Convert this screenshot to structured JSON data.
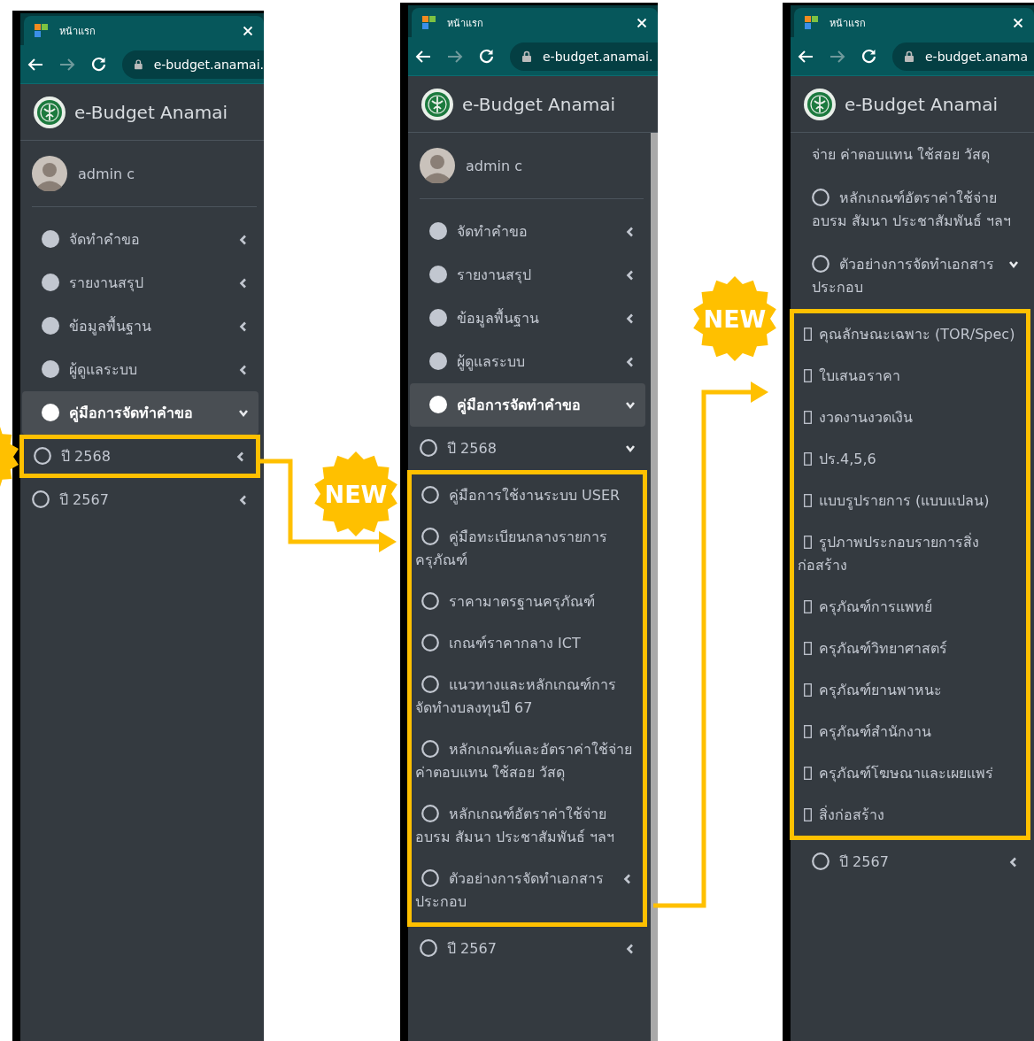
{
  "panels": [
    {
      "browser": {
        "tab_title": "หน้าแรก",
        "url": "e-budget.anamai."
      },
      "app_title": "e-Budget Anamai",
      "user": "admin c",
      "menu": [
        {
          "label": "จัดทำคำขอ",
          "kind": "filled",
          "selected": false,
          "expanded": false
        },
        {
          "label": "รายงานสรุป",
          "kind": "filled",
          "selected": false,
          "expanded": false
        },
        {
          "label": "ข้อมูลพื้นฐาน",
          "kind": "filled",
          "selected": false,
          "expanded": false
        },
        {
          "label": "ผู้ดูแลระบบ",
          "kind": "filled",
          "selected": false,
          "expanded": false
        },
        {
          "label": "คู่มือการจัดทำคำขอ",
          "kind": "filled",
          "selected": true,
          "expanded": true,
          "children": [
            {
              "label": "ปี 2568",
              "kind": "outline",
              "expanded": false,
              "framed": true
            },
            {
              "label": "ปี 2567",
              "kind": "outline",
              "expanded": false,
              "framed": false
            }
          ]
        }
      ]
    },
    {
      "browser": {
        "tab_title": "หน้าแรก",
        "url": "e-budget.anamai."
      },
      "app_title": "e-Budget Anamai",
      "user": "admin c",
      "scrollbar": true,
      "menu": [
        {
          "label": "จัดทำคำขอ",
          "kind": "filled",
          "selected": false,
          "expanded": false
        },
        {
          "label": "รายงานสรุป",
          "kind": "filled",
          "selected": false,
          "expanded": false
        },
        {
          "label": "ข้อมูลพื้นฐาน",
          "kind": "filled",
          "selected": false,
          "expanded": false
        },
        {
          "label": "ผู้ดูแลระบบ",
          "kind": "filled",
          "selected": false,
          "expanded": false
        },
        {
          "label": "คู่มือการจัดทำคำขอ",
          "kind": "filled",
          "selected": true,
          "expanded": true,
          "children": [
            {
              "label": "ปี 2568",
              "kind": "outline",
              "expanded": true,
              "children_framed": true,
              "children": [
                {
                  "label": "คู่มือการใช้งานระบบ USER",
                  "kind": "outline"
                },
                {
                  "label": "คู่มือทะเบียนกลางรายการครุภัณฑ์",
                  "kind": "outline"
                },
                {
                  "label": "ราคามาตรฐานครุภัณฑ์",
                  "kind": "outline"
                },
                {
                  "label": "เกณฑ์ราคากลาง ICT",
                  "kind": "outline"
                },
                {
                  "label": "แนวทางและหลักเกณฑ์การจัดทำงบลงทุนปี 67",
                  "kind": "outline"
                },
                {
                  "label": "หลักเกณฑ์และอัตราค่าใช้จ่าย ค่าตอบแทน ใช้สอย วัสดุ",
                  "kind": "outline"
                },
                {
                  "label": "หลักเกณฑ์อัตราค่าใช้จ่ายอบรม สัมนา ประชาสัมพันธ์ ฯลฯ",
                  "kind": "outline"
                },
                {
                  "label": "ตัวอย่างการจัดทำเอกสารประกอบ",
                  "kind": "outline",
                  "expanded": false
                }
              ]
            },
            {
              "label": "ปี 2567",
              "kind": "outline",
              "expanded": false
            }
          ]
        }
      ]
    },
    {
      "browser": {
        "tab_title": "หน้าแรก",
        "url": "e-budget.anama"
      },
      "app_title": "e-Budget Anamai",
      "menu": [
        {
          "label": "จ่าย ค่าตอบแทน ใช้สอย วัสดุ"
        },
        {
          "label": "หลักเกณฑ์อัตราค่าใช้จ่ายอบรม สัมนา ประชาสัมพันธ์ ฯลฯ",
          "kind": "outline"
        },
        {
          "label": "ตัวอย่างการจัดทำเอกสารประกอบ",
          "kind": "outline",
          "expanded": true,
          "children_framed": true,
          "children": [
            {
              "label": "คุณลักษณะเฉพาะ (TOR/Spec)",
              "kind": "box"
            },
            {
              "label": "ใบเสนอราคา",
              "kind": "box"
            },
            {
              "label": "งวดงานงวดเงิน",
              "kind": "box"
            },
            {
              "label": "ปร.4,5,6",
              "kind": "box"
            },
            {
              "label": "แบบรูปรายการ (แบบแปลน)",
              "kind": "box"
            },
            {
              "label": "รูปภาพประกอบรายการสิ่งก่อสร้าง",
              "kind": "box"
            },
            {
              "label": "ครุภัณฑ์การแพทย์",
              "kind": "box"
            },
            {
              "label": "ครุภัณฑ์วิทยาศาสตร์",
              "kind": "box"
            },
            {
              "label": "ครุภัณฑ์ยานพาหนะ",
              "kind": "box"
            },
            {
              "label": "ครุภัณฑ์สำนักงาน",
              "kind": "box"
            },
            {
              "label": "ครุภัณฑ์โฆษณาและเผยแพร่",
              "kind": "box"
            },
            {
              "label": "สิ่งก่อสร้าง",
              "kind": "box"
            }
          ]
        },
        {
          "label": "ปี 2567",
          "kind": "outline",
          "expanded": false
        }
      ]
    }
  ],
  "badges": [
    "NEW",
    "NEW"
  ]
}
